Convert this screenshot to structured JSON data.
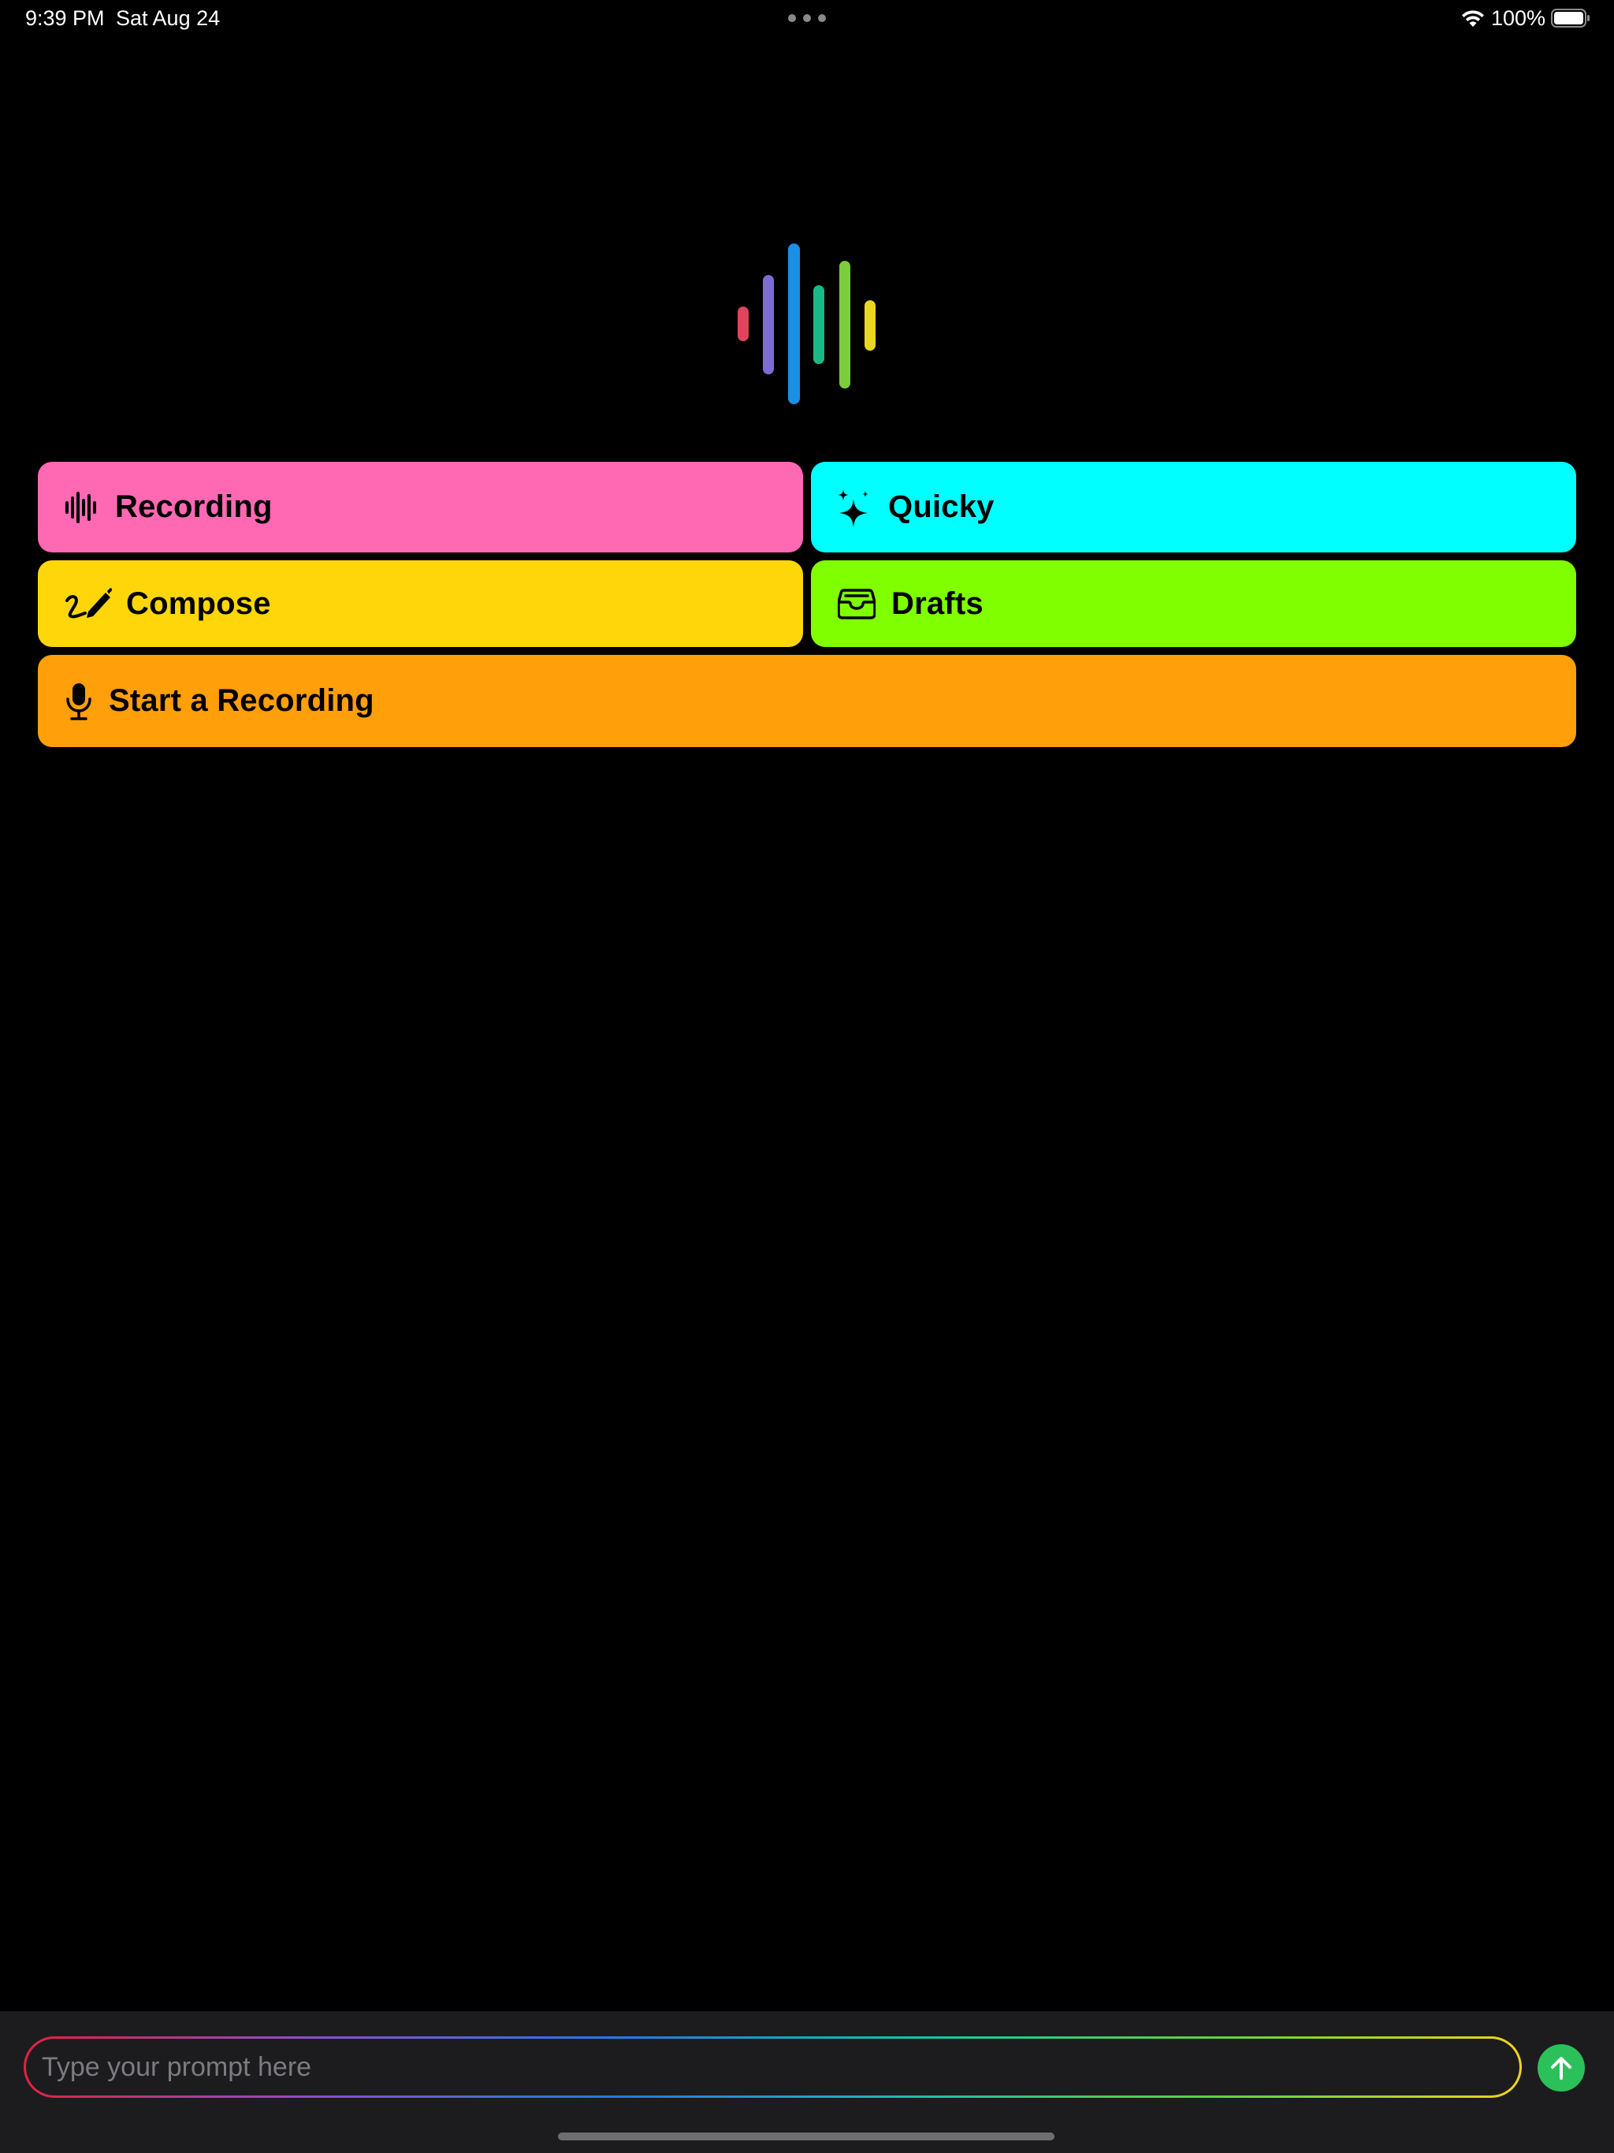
{
  "status_bar": {
    "time": "9:39 PM",
    "date": "Sat Aug 24",
    "battery_percent": "100%",
    "icons": [
      "multitask-dots-icon",
      "wifi-icon",
      "battery-icon"
    ]
  },
  "logo": {
    "name": "waveform-logo",
    "colors": [
      "#e0435b",
      "#7f6bd6",
      "#1a8fe3",
      "#19b887",
      "#7ccc3c",
      "#e9d523"
    ]
  },
  "tiles": {
    "recording": {
      "label": "Recording",
      "icon": "waveform-icon",
      "color": "#ff69b4"
    },
    "quicky": {
      "label": "Quicky",
      "icon": "sparkles-icon",
      "color": "#00ffff"
    },
    "compose": {
      "label": "Compose",
      "icon": "scribble-pencil-icon",
      "color": "#ffd60a"
    },
    "drafts": {
      "label": "Drafts",
      "icon": "tray-icon",
      "color": "#7fff00"
    },
    "start": {
      "label": "Start a Recording",
      "icon": "microphone-icon",
      "color": "#ff9f0a"
    }
  },
  "prompt": {
    "placeholder": "Type your prompt here",
    "value": "",
    "send_icon": "arrow-up-icon",
    "send_color": "#2cc05a"
  }
}
